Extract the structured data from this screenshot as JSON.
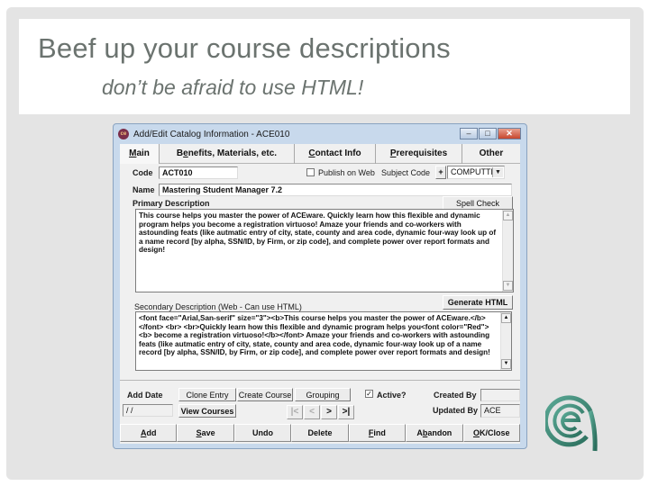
{
  "slide": {
    "title": "Beef up your course descriptions",
    "subtitle": "don’t be afraid to use HTML!"
  },
  "window": {
    "title": "Add/Edit Catalog Information - ACE010",
    "app_icon": "ace-app-icon",
    "controls": {
      "minimize": "–",
      "maximize": "□",
      "close": "✕"
    }
  },
  "tabs": [
    {
      "label": "Main",
      "accel": "M",
      "rest": "ain",
      "active": true
    },
    {
      "label": "Benefits, Materials, etc.",
      "pre": "B",
      "accel": "e",
      "rest": "nefits, Materials, etc.",
      "active": false
    },
    {
      "label": "Contact Info",
      "accel": "C",
      "rest": "ontact Info",
      "active": false
    },
    {
      "label": "Prerequisites",
      "accel": "P",
      "rest": "rerequisites",
      "active": false
    },
    {
      "label": "Other",
      "accel": "",
      "rest": "Other",
      "active": false
    }
  ],
  "form": {
    "code_label": "Code",
    "code_value": "ACT010",
    "publish_label": "Publish on Web",
    "publish_checked": false,
    "subject_code_label": "Subject Code",
    "subject_plus": "+",
    "subject_code_value": "COMPUTTR",
    "dropdown_arrow": "▼",
    "name_label": "Name",
    "name_value": "Mastering Student Manager 7.2",
    "primary_label": "Primary Description",
    "spell_check_label": "Spell Check",
    "primary_text": "This course helps you master the  power of ACEware.    Quickly learn how this flexible and  dynamic program helps you become a registration  virtuoso!     Amaze your friends and co-workers with astounding feats  (like autmatic entry of city, state, county and area code, dynamic four-way  look up of a name record [by alpha, SSN/ID, by Firm, or zip code], and  complete power over report formats and design!",
    "secondary_label": "Secondary Description (Web - Can use HTML)",
    "generate_html_label": "Generate HTML",
    "secondary_text": "<font face=\"Arial,San-serif\" size=\"3\"><b>This course helps you master the  power of ACEware.</b> </font> <br> <br>Quickly learn how this flexible and  dynamic program helps you<font color=\"Red\"><b> become a registration  virtuoso!</b></font>  Amaze your friends and co-workers with astounding feats  (like autmatic entry of city, state, county and area code, dynamic four-way  look up of a name record [by alpha, SSN/ID, by Firm, or zip code], and  complete power over report formats and design!",
    "scroll_up": "▲",
    "scroll_down": "▼"
  },
  "lower": {
    "add_date_label": "Add Date",
    "add_date_value": "/ /",
    "clone_entry_label": "Clone Entry",
    "create_course_label": "Create Course",
    "grouping_label": "Grouping",
    "view_courses_label": "View Courses",
    "active_label": "Active?",
    "active_checked": true,
    "check_mark": "✓",
    "created_by_label": "Created By",
    "created_by_value": "",
    "updated_by_label": "Updated By",
    "updated_by_value": "ACE",
    "nav": {
      "first": "|<",
      "prev": "<",
      "next": ">",
      "last": ">|"
    }
  },
  "bottom_buttons": [
    {
      "label": "Add",
      "accel": "A",
      "rest": "dd"
    },
    {
      "label": "Save",
      "accel": "S",
      "rest": "ave"
    },
    {
      "label": "Undo",
      "accel": "",
      "rest": "Undo"
    },
    {
      "label": "Delete",
      "accel": "",
      "rest": "Delete"
    },
    {
      "label": "Find",
      "accel": "F",
      "rest": "ind"
    },
    {
      "label": "Abandon",
      "pre": "A",
      "accel": "b",
      "rest": "andon"
    },
    {
      "label": "OK/Close",
      "accel": "O",
      "rest": "K/Close"
    }
  ],
  "colors": {
    "logo_green": "#3f8f7a",
    "title_gray": "#6b736f",
    "window_frame": "#c8d9ec",
    "close_red": "#c6462d"
  }
}
